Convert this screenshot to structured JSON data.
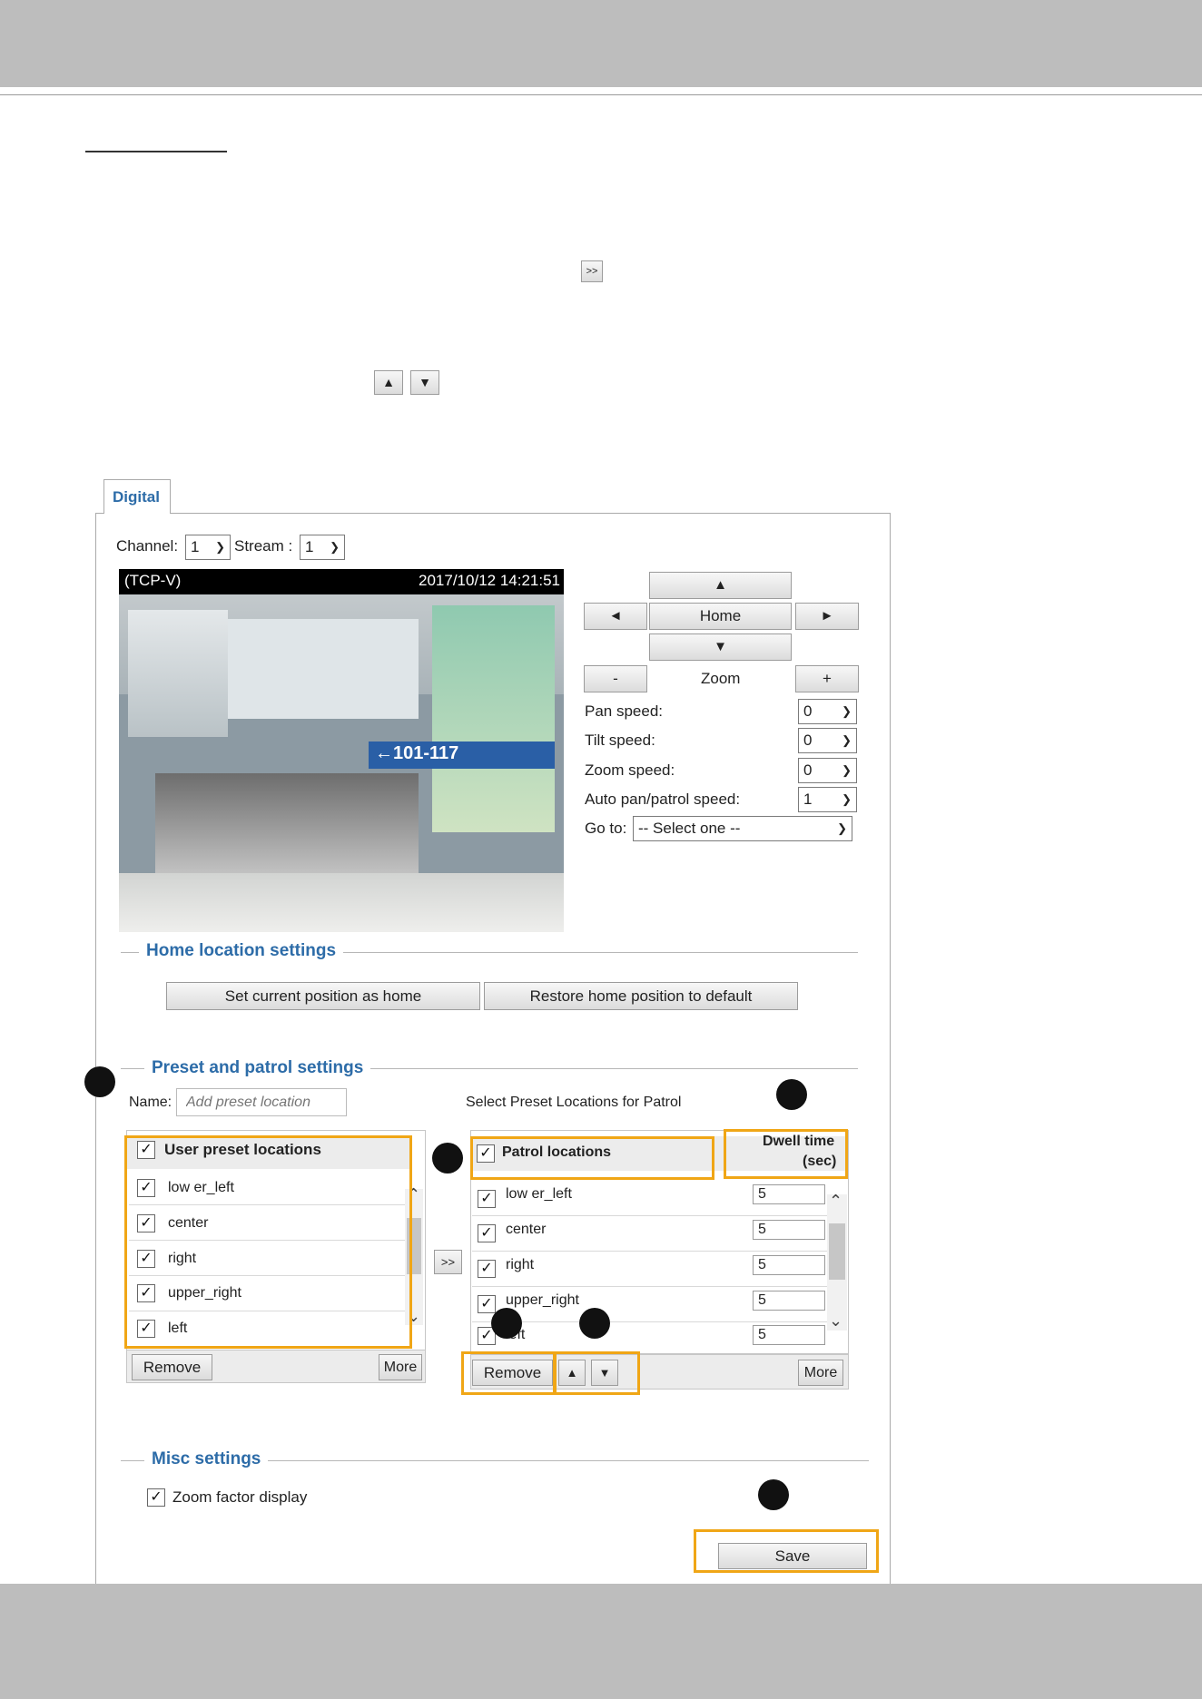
{
  "doc": {
    "inline_add_icon_label": ">>",
    "inline_up_icon": "▲",
    "inline_down_icon": "▼"
  },
  "tab": {
    "label": "Digital"
  },
  "top_controls": {
    "channel_label": "Channel:",
    "channel_value": "1",
    "stream_label": "Stream :",
    "stream_value": "1"
  },
  "video": {
    "protocol": "(TCP-V)",
    "timestamp": "2017/10/12 14:21:51",
    "sign_text": "←101-117"
  },
  "ptz": {
    "up": "▲",
    "down": "▼",
    "left": "◄",
    "right": "►",
    "home": "Home",
    "zoom_label": "Zoom",
    "zoom_out": "-",
    "zoom_in": "+",
    "pan_speed_label": "Pan speed:",
    "pan_speed": "0",
    "tilt_speed_label": "Tilt speed:",
    "tilt_speed": "0",
    "zoom_speed_label": "Zoom speed:",
    "zoom_speed": "0",
    "auto_speed_label": "Auto pan/patrol speed:",
    "auto_speed": "1",
    "goto_label": "Go to:",
    "goto_value": "-- Select one --"
  },
  "home_settings": {
    "title": "Home location settings",
    "set_home": "Set current position as home",
    "restore_home": "Restore home position to default"
  },
  "preset": {
    "title": "Preset and patrol settings",
    "name_label": "Name:",
    "name_placeholder": "Add preset location",
    "patrol_header": "Select Preset Locations for Patrol",
    "user_list_title": "User preset locations",
    "user_items": [
      "low er_left",
      "center",
      "right",
      "upper_right",
      "left"
    ],
    "add_button": ">>",
    "patrol_list_title": "Patrol locations",
    "dwell_title_1": "Dwell time",
    "dwell_title_2": "(sec)",
    "patrol_items": [
      {
        "name": "low er_left",
        "dwell": "5"
      },
      {
        "name": "center",
        "dwell": "5"
      },
      {
        "name": "right",
        "dwell": "5"
      },
      {
        "name": "upper_right",
        "dwell": "5"
      },
      {
        "name": "left",
        "dwell": "5"
      }
    ],
    "remove_label": "Remove",
    "more_label": "More",
    "move_up": "▲",
    "move_down": "▼"
  },
  "misc": {
    "title": "Misc settings",
    "zoom_factor_label": "Zoom factor display"
  },
  "save_label": "Save",
  "check_mark": "✓",
  "colors": {
    "accent": "#2d6ca8",
    "highlight": "#f0a616",
    "band": "#bdbdbd"
  }
}
